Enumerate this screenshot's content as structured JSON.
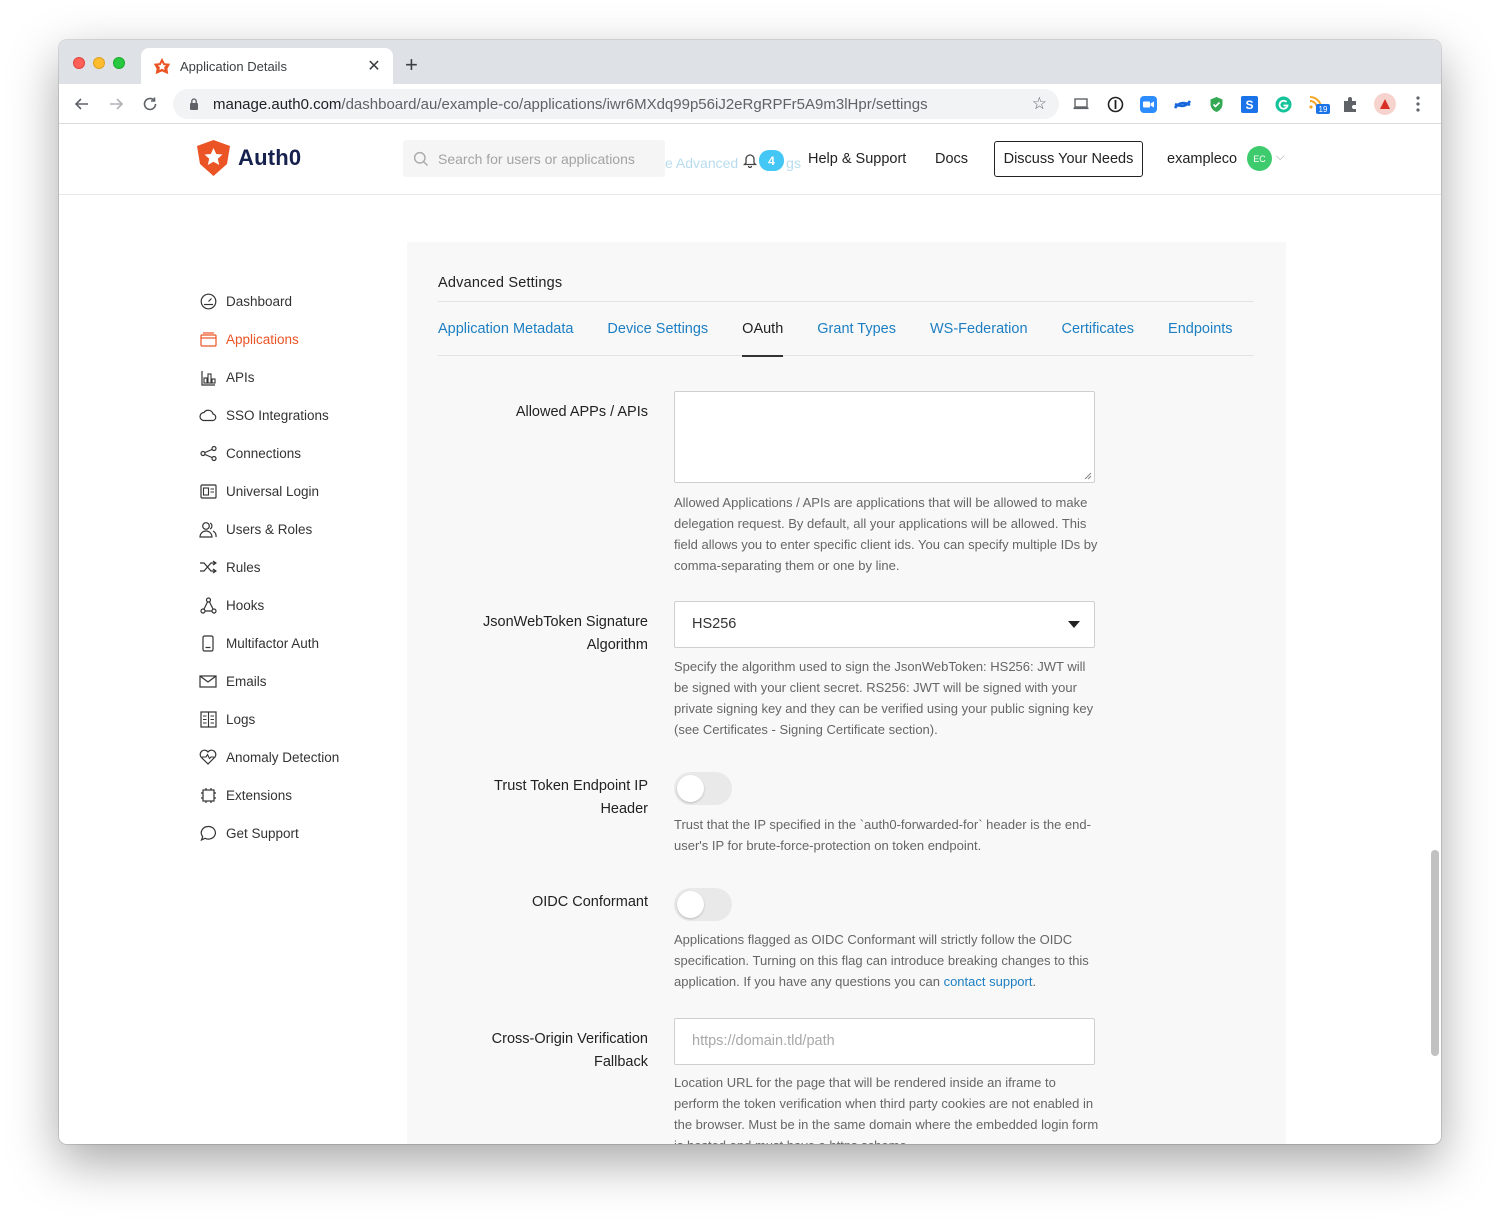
{
  "browser": {
    "tab_title": "Application Details",
    "url_host": "manage.auth0.com",
    "url_path": "/dashboard/au/example-co/applications/iwr6MXdq99p56iJ2eRgRPFr5A9m3lHpr/settings",
    "ext_badge": "19"
  },
  "header": {
    "logo_text": "Auth0",
    "search_placeholder": "Search for users or applications",
    "ghost_text": "e Advanced",
    "ghost_text_tail": "gs",
    "notifications": "4",
    "help_label": "Help & Support",
    "docs_label": "Docs",
    "discuss_label": "Discuss Your Needs",
    "tenant": "exampleco",
    "avatar_initials": "EC"
  },
  "sidebar": {
    "items": [
      {
        "label": "Dashboard",
        "icon": "dashboard-icon"
      },
      {
        "label": "Applications",
        "icon": "applications-icon",
        "active": true
      },
      {
        "label": "APIs",
        "icon": "apis-icon"
      },
      {
        "label": "SSO Integrations",
        "icon": "cloud-icon"
      },
      {
        "label": "Connections",
        "icon": "connections-icon"
      },
      {
        "label": "Universal Login",
        "icon": "login-icon"
      },
      {
        "label": "Users & Roles",
        "icon": "users-icon"
      },
      {
        "label": "Rules",
        "icon": "rules-icon"
      },
      {
        "label": "Hooks",
        "icon": "hooks-icon"
      },
      {
        "label": "Multifactor Auth",
        "icon": "phone-icon"
      },
      {
        "label": "Emails",
        "icon": "mail-icon"
      },
      {
        "label": "Logs",
        "icon": "logs-icon"
      },
      {
        "label": "Anomaly Detection",
        "icon": "heart-icon"
      },
      {
        "label": "Extensions",
        "icon": "extensions-icon"
      },
      {
        "label": "Get Support",
        "icon": "chat-icon"
      }
    ]
  },
  "settings": {
    "title": "Advanced Settings",
    "tabs": [
      "Application Metadata",
      "Device Settings",
      "OAuth",
      "Grant Types",
      "WS-Federation",
      "Certificates",
      "Endpoints"
    ],
    "active_tab": "OAuth",
    "allowed_apps": {
      "label": "Allowed APPs / APIs",
      "value": "",
      "help": "Allowed Applications / APIs are applications that will be allowed to make delegation request. By default, all your applications will be allowed. This field allows you to enter specific client ids. You can specify multiple IDs by comma-separating them or one by line."
    },
    "jwt_alg": {
      "label_line1": "JsonWebToken Signature",
      "label_line2": "Algorithm",
      "value": "HS256",
      "help": "Specify the algorithm used to sign the JsonWebToken: HS256: JWT will be signed with your client secret. RS256: JWT will be signed with your private signing key and they can be verified using your public signing key (see Certificates - Signing Certificate section)."
    },
    "trust_ip": {
      "label_line1": "Trust Token Endpoint IP",
      "label_line2": "Header",
      "enabled": false,
      "help": "Trust that the IP specified in the `auth0-forwarded-for` header is the end-user's IP for brute-force-protection on token endpoint."
    },
    "oidc": {
      "label": "OIDC Conformant",
      "enabled": false,
      "help_before": "Applications flagged as OIDC Conformant will strictly follow the OIDC specification. Turning on this flag can introduce breaking changes to this application. If you have any questions you can ",
      "help_link": "contact support",
      "help_after": "."
    },
    "cross_origin": {
      "label_line1": "Cross-Origin Verification",
      "label_line2": "Fallback",
      "placeholder": "https://domain.tld/path",
      "value": "",
      "help": "Location URL for the page that will be rendered inside an iframe to perform the token verification when third party cookies are not enabled in the browser. Must be in the same domain where the embedded login form is hosted and must have a https scheme."
    }
  },
  "colors": {
    "brand": "#eb5424",
    "link": "#1c7fc3",
    "badge": "#44c7f4",
    "avatar": "#3ecb6e"
  }
}
